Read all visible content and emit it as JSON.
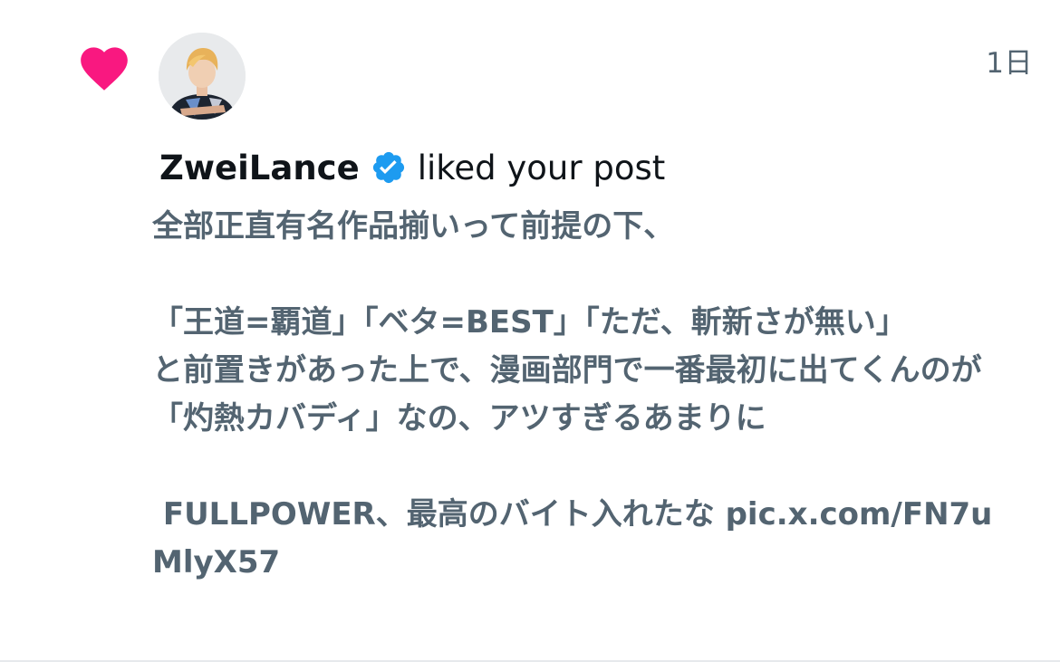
{
  "notification": {
    "type": "like",
    "timestamp": "1日",
    "actor": {
      "name": "ZweiLance",
      "verified": true,
      "avatar_icon": "user-avatar"
    },
    "action_text": "liked your post",
    "post": {
      "text": "全部正直有名作品揃いって前提の下、\n\n「王道=覇道」「ベタ=BEST」「ただ、斬新さが無い」\nと前置きがあった上で、漫画部門で一番最初に出てくんのが\n「灼熱カバディ」なの、アツすぎるあまりに\n\n FULLPOWER、最高のバイト入れたな ",
      "link": "pic.x.com/FN7uMlyX57"
    }
  },
  "icons": {
    "like": "heart-icon",
    "verified": "verified-badge-icon"
  },
  "colors": {
    "heart": "#f91880",
    "verified": "#1d9bf0",
    "primary_text": "#0f1419",
    "secondary_text": "#536471",
    "divider": "#e6e9ec"
  }
}
